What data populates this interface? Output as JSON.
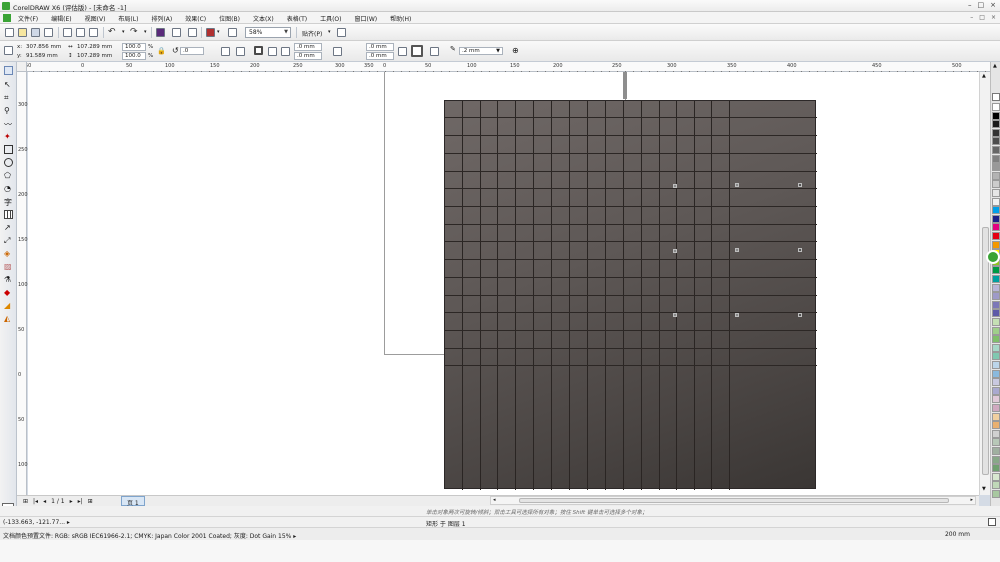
{
  "window": {
    "title": "CorelDRAW X6 (评估版) - [未命名 -1]",
    "controls": [
      "–",
      "□",
      "×"
    ]
  },
  "menu": {
    "items": [
      "文件(F)",
      "编辑(E)",
      "视图(V)",
      "布局(L)",
      "排列(A)",
      "效果(C)",
      "位图(B)",
      "文本(X)",
      "表格(T)",
      "工具(O)",
      "窗口(W)",
      "帮助(H)"
    ],
    "doc_controls": [
      "–",
      "□",
      "×"
    ]
  },
  "toolbar": {
    "zoom": "58%",
    "snap": "贴齐(P)"
  },
  "properties": {
    "x": "307.856 mm",
    "y": "91.589 mm",
    "width": "107.289 mm",
    "height": "107.289 mm",
    "scale_x": "100.0",
    "scale_y": "100.0",
    "percent": "%",
    "angle": ".0",
    "offset_a": ".0 mm",
    "offset_b": ".0 mm",
    "corner_a": ".0 mm",
    "corner_b": ".0 mm",
    "outline_width": ".2 mm",
    "label_x": "x:",
    "label_y": "y:"
  },
  "rulers": {
    "h_labels": [
      "50",
      "0",
      "50",
      "100",
      "150",
      "200",
      "250",
      "300",
      "350",
      "0",
      "50",
      "100",
      "150",
      "200",
      "250",
      "300",
      "350",
      "400",
      "450",
      "500"
    ],
    "v_labels": [
      "300",
      "250",
      "200",
      "150",
      "100",
      "50",
      "0",
      "50",
      "100"
    ]
  },
  "pagenav": {
    "page_count": "1 / 1",
    "page_tab": "页 1"
  },
  "status": {
    "hint": "单击对象两次可旋转/倾斜；双击工具可选择所有对象；按住 Shift 键单击可选择多个对象；按住 Alt 键单击可进行挖掘；按住 Ctrl 并单击可在组中选择",
    "coords": "(-133.663, -121.77... ▸",
    "object_info": "矩形 于 图层 1",
    "color_profile": "文档颜色预置文件: RGB: sRGB IEC61966-2.1; CMYK: Japan Color 2001 Coated; 灰度: Dot Gain 15% ▸",
    "page_size": "200 mm"
  },
  "colors": {
    "canvas": "#ffffff",
    "rect_fill_top": "#6f6866",
    "rect_fill_bottom": "#3a3634",
    "accent_tab": "#d8e6f5"
  },
  "palette": [
    "#ffffff",
    "#000000",
    "#1a1a1a",
    "#333333",
    "#4d4d4d",
    "#666666",
    "#808080",
    "#999999",
    "#b3b3b3",
    "#cccccc",
    "#e6e6e6",
    "#f2f2f2",
    "#00a0e9",
    "#1d2088",
    "#e4007f",
    "#e60012",
    "#f39800",
    "#fff100",
    "#8fc31f",
    "#009944",
    "#00a0a0",
    "#b9b5d8",
    "#9e9ac8",
    "#7c78b8",
    "#5e5aa8",
    "#c5e0b4",
    "#9fcf8a",
    "#7fbf6a",
    "#a7d8c8",
    "#80c8b0",
    "#bcd6ea",
    "#8ab9dd",
    "#c9c9e0",
    "#a9a9cf",
    "#e0c9d8",
    "#d0a9c0",
    "#f0d0a0",
    "#e8b070",
    "#d0d0d0",
    "#b8c8b8",
    "#a0b0a0",
    "#88a888",
    "#70a070",
    "#d8e8d0",
    "#c0d8b8",
    "#a8c8a0"
  ],
  "icons": [
    "new-icon",
    "open-icon",
    "save-icon",
    "print-icon",
    "cut-icon",
    "copy-icon",
    "paste-icon",
    "undo-icon",
    "redo-icon",
    "import-icon",
    "export-icon",
    "publish-icon",
    "app-launcher-icon",
    "options-icon"
  ]
}
